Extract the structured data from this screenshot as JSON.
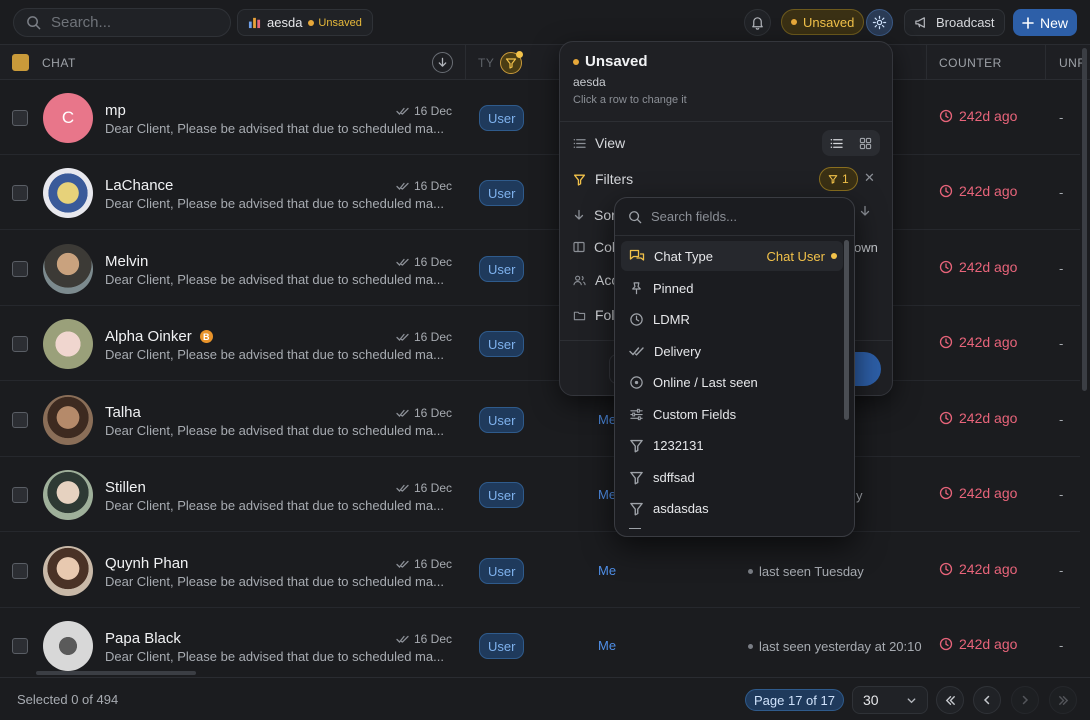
{
  "topbar": {
    "search_placeholder": "Search...",
    "view_name": "aesda",
    "view_status": "Unsaved",
    "unsaved_pill": "Unsaved",
    "broadcast_label": "Broadcast",
    "new_label": "New"
  },
  "table": {
    "columns": {
      "chat": "CHAT",
      "type_partial": "TY",
      "counter": "COUNTER",
      "unr_partial": "UNR"
    },
    "rows": [
      {
        "name": "mp",
        "initial": "C",
        "preview": "Dear Client, Please be advised that due to scheduled ma...",
        "date": "16 Dec",
        "type": "User",
        "assignee": "",
        "seen": "",
        "counter": "242d ago",
        "unread": "-",
        "avatar_color": "#e8768a",
        "badge": ""
      },
      {
        "name": "LaChance",
        "initial": "",
        "preview": "Dear Client, Please be advised that due to scheduled ma...",
        "date": "16 Dec",
        "type": "User",
        "assignee": "",
        "seen": "",
        "counter": "242d ago",
        "unread": "-",
        "avatar_color": "#c9b46a",
        "badge": ""
      },
      {
        "name": "Melvin",
        "initial": "",
        "preview": "Dear Client, Please be advised that due to scheduled ma...",
        "date": "16 Dec",
        "type": "User",
        "assignee": "",
        "seen": "",
        "counter": "242d ago",
        "unread": "-",
        "avatar_color": "#7a6a55",
        "badge": ""
      },
      {
        "name": "Alpha Oinker",
        "initial": "",
        "preview": "Dear Client, Please be advised that due to scheduled ma...",
        "date": "16 Dec",
        "type": "User",
        "assignee": "",
        "seen": "",
        "counter": "242d ago",
        "unread": "-",
        "avatar_color": "#d8c8b8",
        "badge": "B"
      },
      {
        "name": "Talha",
        "initial": "",
        "preview": "Dear Client, Please be advised that due to scheduled ma...",
        "date": "16 Dec",
        "type": "User",
        "assignee": "Me",
        "seen": "",
        "counter": "242d ago",
        "unread": "-",
        "avatar_color": "#8a6a4e",
        "badge": ""
      },
      {
        "name": "Stillen",
        "initial": "",
        "preview": "Dear Client, Please be advised that due to scheduled ma...",
        "date": "16 Dec",
        "type": "User",
        "assignee": "Me",
        "seen": "y",
        "counter": "242d ago",
        "unread": "-",
        "avatar_color": "#5f6e5a",
        "badge": ""
      },
      {
        "name": "Quynh Phan",
        "initial": "",
        "preview": "Dear Client, Please be advised that due to scheduled ma...",
        "date": "16 Dec",
        "type": "User",
        "assignee": "Me",
        "seen": "last seen Tuesday",
        "counter": "242d ago",
        "unread": "-",
        "avatar_color": "#b8987e",
        "badge": ""
      },
      {
        "name": "Papa Black",
        "initial": "",
        "preview": "Dear Client, Please be advised that due to scheduled ma...",
        "date": "16 Dec",
        "type": "User",
        "assignee": "Me",
        "seen": "last seen yesterday at 20:10",
        "counter": "242d ago",
        "unread": "-",
        "avatar_color": "#c9c9c9",
        "badge": ""
      }
    ]
  },
  "panel": {
    "title": "Unsaved",
    "view_name": "aesda",
    "hint": "Click a row to change it",
    "view_label": "View",
    "filters_label": "Filters",
    "filters_count": "1",
    "sort_partial": "Sor",
    "columns_partial": "Col",
    "access_partial": "Acc",
    "folder_partial": "Fol",
    "own_partial": "own",
    "save_partial": "da"
  },
  "field_popup": {
    "search_placeholder": "Search fields...",
    "items": [
      {
        "label": "Chat Type",
        "value": "Chat User",
        "icon": "chat-type-icon"
      },
      {
        "label": "Pinned",
        "value": "",
        "icon": "pin-icon"
      },
      {
        "label": "LDMR",
        "value": "",
        "icon": "clock-icon"
      },
      {
        "label": "Delivery",
        "value": "",
        "icon": "double-check-icon"
      },
      {
        "label": "Online / Last seen",
        "value": "",
        "icon": "online-icon"
      },
      {
        "label": "Custom Fields",
        "value": "",
        "icon": "sliders-icon"
      },
      {
        "label": "1232131",
        "value": "",
        "icon": "funnel-icon"
      },
      {
        "label": "sdffsad",
        "value": "",
        "icon": "funnel-icon"
      },
      {
        "label": "asdasdas",
        "value": "",
        "icon": "funnel-icon"
      }
    ]
  },
  "footer": {
    "selected": "Selected 0 of 494",
    "page": "Page 17 of 17",
    "page_size": "30"
  },
  "colors": {
    "accent": "#2d5fa8",
    "warning": "#f2c24a",
    "counter": "#e8647a"
  }
}
